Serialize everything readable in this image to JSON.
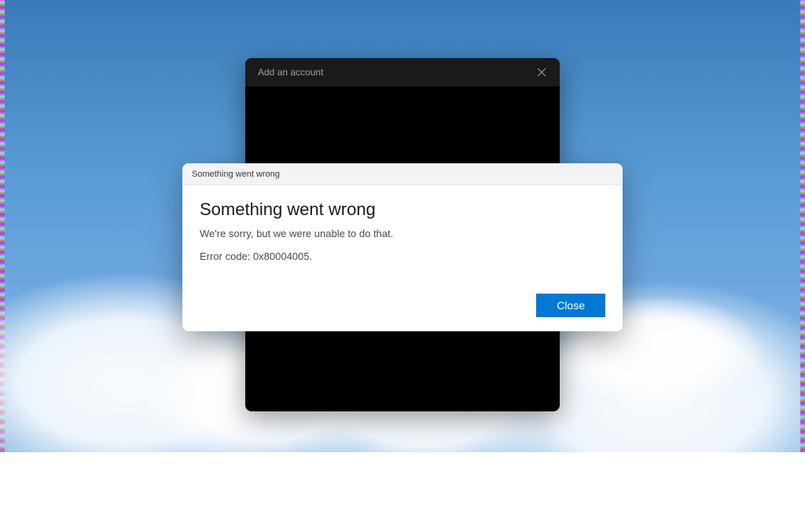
{
  "parent_dialog": {
    "title": "Add an account"
  },
  "error_dialog": {
    "titlebar": "Something went wrong",
    "heading": "Something went wrong",
    "message": "We're sorry, but we were unable to do that.",
    "error_code_line": "Error code: 0x80004005.",
    "close_button": "Close"
  }
}
